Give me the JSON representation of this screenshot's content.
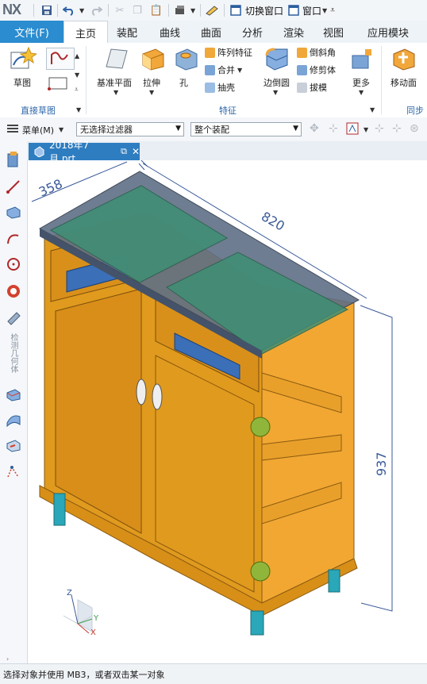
{
  "app": {
    "logo": "NX",
    "quick_access": {
      "switch_window_label": "切换窗口",
      "window_label": "窗口"
    }
  },
  "ribbon": {
    "file_tab": "文件(F)",
    "tabs": [
      "主页",
      "装配",
      "曲线",
      "曲面",
      "分析",
      "渲染",
      "视图",
      "应用模块"
    ],
    "active_tab": "主页",
    "direct_sketch": {
      "sketch_label": "草图",
      "group_label": "直接草图"
    },
    "feature": {
      "datum_plane_label": "基准平面",
      "extrude_label": "拉伸",
      "hole_label": "孔",
      "pattern_feature_label": "阵列特征",
      "unite_label": "合并",
      "shell_label": "抽壳",
      "edge_blend_label": "边倒圆",
      "chamfer_label": "倒斜角",
      "trim_body_label": "修剪体",
      "draft_label": "拔模",
      "more_label": "更多",
      "group_label": "特征"
    },
    "sync_modeling": {
      "move_face_label": "移动面",
      "group_label": "同步建"
    }
  },
  "filter_bar": {
    "menu_label": "菜单(M)",
    "type_filter": "无选择过滤器",
    "scope_filter": "整个装配"
  },
  "left_toolbar": {
    "vertical_text": "检测几何体"
  },
  "document": {
    "tab_title": "2018年7月.prt"
  },
  "model": {
    "dimension_depth": "358",
    "dimension_width": "820",
    "dimension_height": "937",
    "triad_z": "Z",
    "triad_y": "Y",
    "triad_x": "X"
  },
  "status": {
    "prompt": "选择对象并使用 MB3，或者双击某一对象"
  },
  "colors": {
    "accent": "#2b8ccf",
    "cabinet_wood": "#e09a1e",
    "glass_top": "#5f6f86",
    "glass_green": "#3f8f74",
    "dimension_line": "#3a5a9a"
  }
}
